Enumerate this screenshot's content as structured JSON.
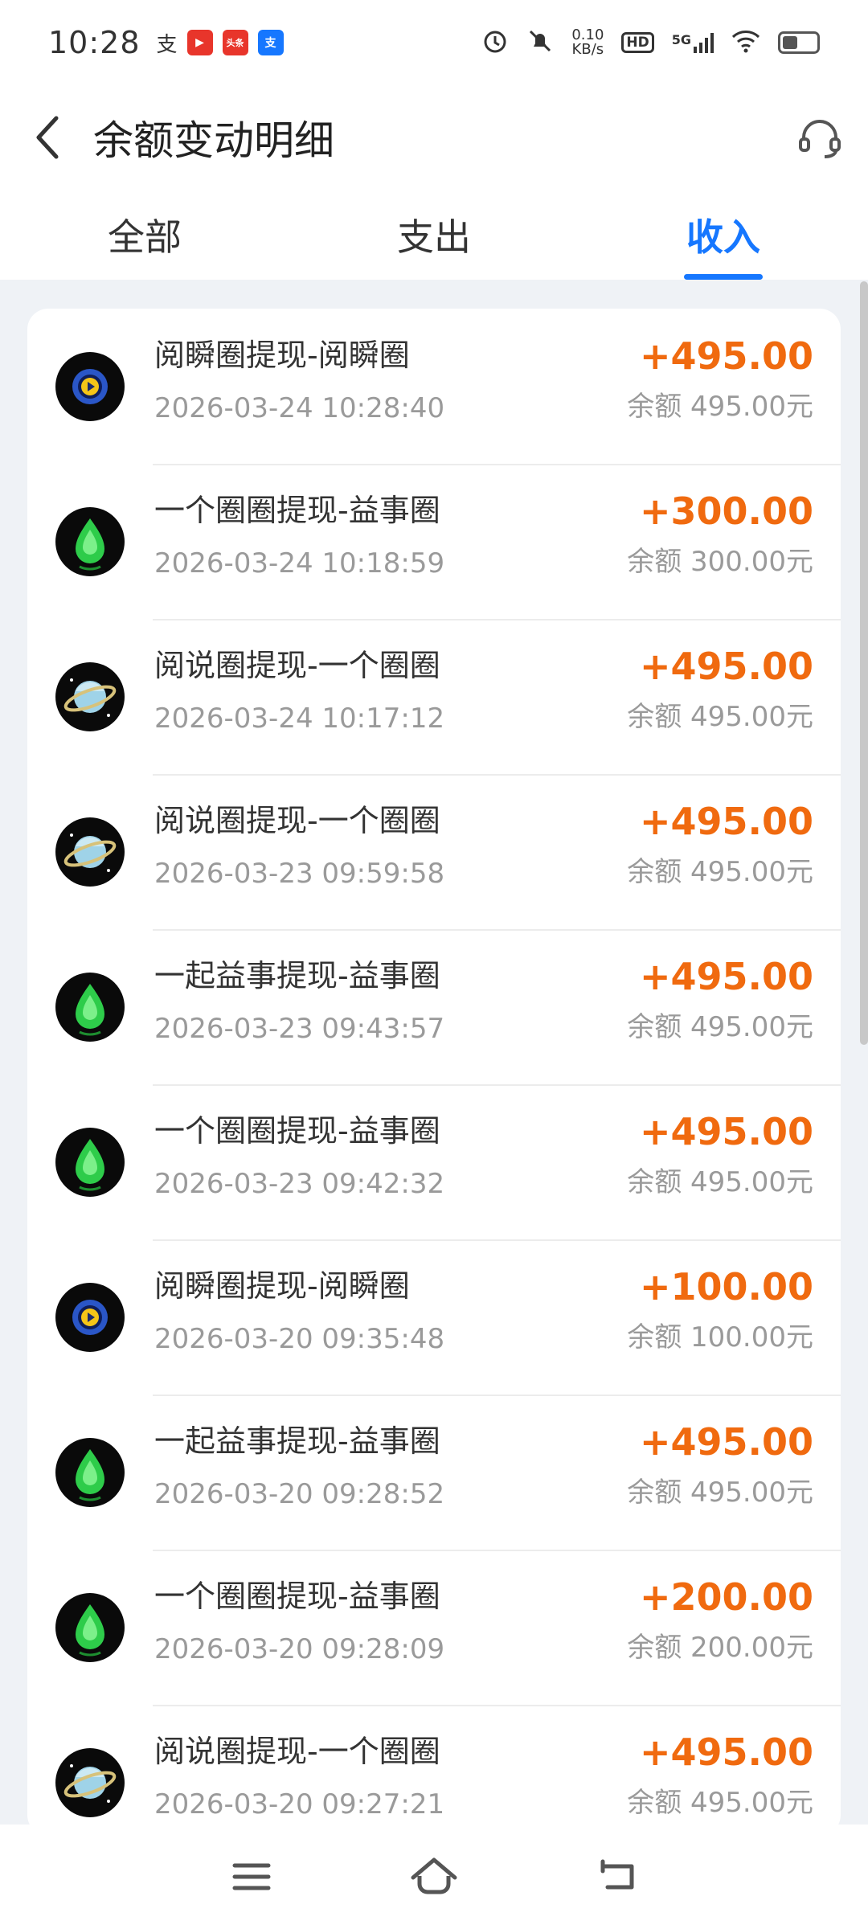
{
  "status_bar": {
    "time": "10:28",
    "net_speed_value": "0.10",
    "net_speed_unit": "KB/s",
    "hd_label": "HD",
    "network_label": "5G",
    "apps": [
      "alipay",
      "video-app",
      "toutiao-app",
      "alipay-badge"
    ]
  },
  "header": {
    "title": "余额变动明细"
  },
  "tabs": [
    {
      "label": "全部",
      "active": false
    },
    {
      "label": "支出",
      "active": false
    },
    {
      "label": "收入",
      "active": true
    }
  ],
  "colors": {
    "accent": "#1677ff",
    "amount": "#f06a0f",
    "muted": "#9a9a9a",
    "background": "#eff2f6"
  },
  "transactions": [
    {
      "icon": "film-reel-icon",
      "title": "阅瞬圈提现-阅瞬圈",
      "time": "2026-03-24 10:28:40",
      "amount": "+495.00",
      "balance": "余额 495.00元"
    },
    {
      "icon": "green-droplet-icon",
      "title": "一个圈圈提现-益事圈",
      "time": "2026-03-24 10:18:59",
      "amount": "+300.00",
      "balance": "余额 300.00元"
    },
    {
      "icon": "planet-icon",
      "title": "阅说圈提现-一个圈圈",
      "time": "2026-03-24 10:17:12",
      "amount": "+495.00",
      "balance": "余额 495.00元"
    },
    {
      "icon": "planet-icon",
      "title": "阅说圈提现-一个圈圈",
      "time": "2026-03-23 09:59:58",
      "amount": "+495.00",
      "balance": "余额 495.00元"
    },
    {
      "icon": "green-droplet-icon",
      "title": "一起益事提现-益事圈",
      "time": "2026-03-23 09:43:57",
      "amount": "+495.00",
      "balance": "余额 495.00元"
    },
    {
      "icon": "green-droplet-icon",
      "title": "一个圈圈提现-益事圈",
      "time": "2026-03-23 09:42:32",
      "amount": "+495.00",
      "balance": "余额 495.00元"
    },
    {
      "icon": "film-reel-icon",
      "title": "阅瞬圈提现-阅瞬圈",
      "time": "2026-03-20 09:35:48",
      "amount": "+100.00",
      "balance": "余额 100.00元"
    },
    {
      "icon": "green-droplet-icon",
      "title": "一起益事提现-益事圈",
      "time": "2026-03-20 09:28:52",
      "amount": "+495.00",
      "balance": "余额 495.00元"
    },
    {
      "icon": "green-droplet-icon",
      "title": "一个圈圈提现-益事圈",
      "time": "2026-03-20 09:28:09",
      "amount": "+200.00",
      "balance": "余额 200.00元"
    },
    {
      "icon": "planet-icon",
      "title": "阅说圈提现-一个圈圈",
      "time": "2026-03-20 09:27:21",
      "amount": "+495.00",
      "balance": "余额 495.00元"
    }
  ],
  "nav_bar": {
    "buttons": [
      "menu-icon",
      "home-icon",
      "back-arrow-icon"
    ]
  }
}
